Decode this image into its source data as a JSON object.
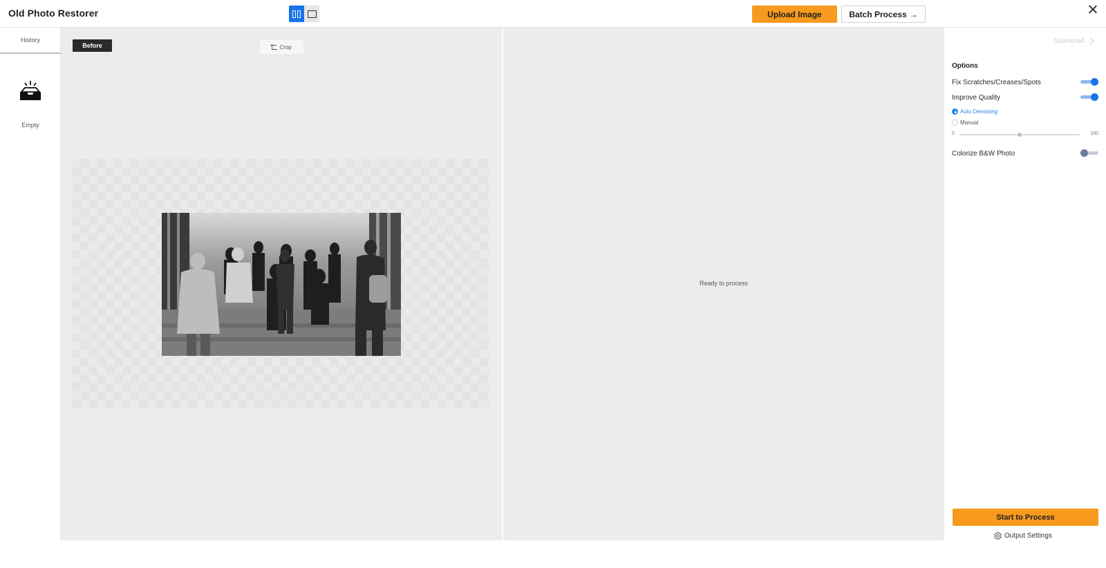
{
  "app": {
    "title": "Old Photo Restorer"
  },
  "header": {
    "view_toggle": {
      "active": "split",
      "options": [
        "split-view",
        "single-view"
      ]
    },
    "upload_label": "Upload Image",
    "batch_label": "Batch Process",
    "batch_arrow": "→",
    "accent_color": "#f79a1e",
    "primary_blue": "#1a73e8"
  },
  "sidebar": {
    "tab_label": "History",
    "empty_label": "Empty"
  },
  "before_pane": {
    "badge": "Before",
    "crop_label": "Crop"
  },
  "after_pane": {
    "status": "Ready to process"
  },
  "options": {
    "download_label": "Download",
    "title": "Options",
    "fix_scratches": {
      "label": "Fix Scratches/Creases/Spots",
      "on": true
    },
    "improve_quality": {
      "label": "Improve Quality",
      "on": true
    },
    "denoise_auto": {
      "label": "Auto Denoising",
      "checked": true
    },
    "denoise_manual": {
      "label": "Manual",
      "checked": false
    },
    "denoise_slider": {
      "min": "0",
      "max": "100",
      "value": 50
    },
    "colorize": {
      "label": "Colorize B&W Photo",
      "on": false
    },
    "start_label": "Start to Process",
    "output_label": "Output Settings"
  }
}
